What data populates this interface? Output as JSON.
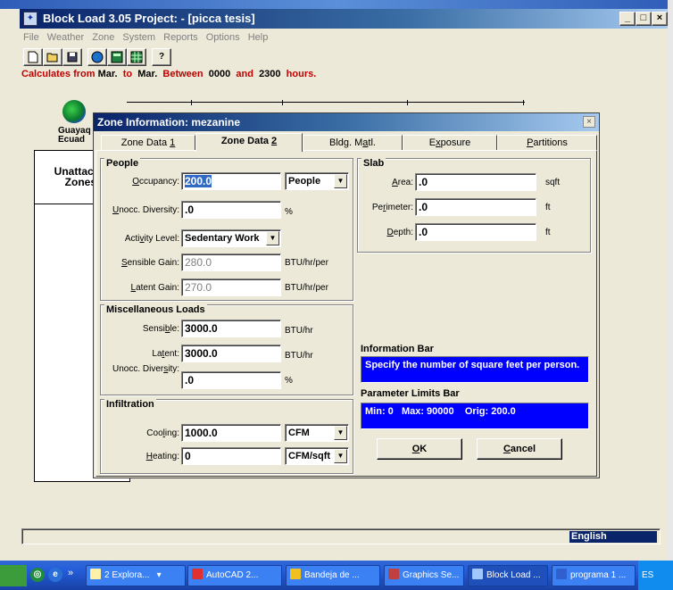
{
  "window": {
    "title": "Block Load  3.05   Project: - [picca tesis]",
    "min_glyph": "_",
    "max_glyph": "□",
    "close_glyph": "×"
  },
  "menu": [
    "File",
    "Weather",
    "Zone",
    "System",
    "Reports",
    "Options",
    "Help"
  ],
  "toolbar": [
    "new-icon",
    "open-icon",
    "save-icon",
    "globe-icon",
    "calc-icon",
    "grid-icon",
    "help-icon"
  ],
  "toolbar_help_glyph": "?",
  "calc_line": {
    "prefix": "Calculates from",
    "from": "Mar.",
    "to_word": "to",
    "to": "Mar.",
    "between_word": "Between",
    "start": "0000",
    "and_word": "and",
    "end": "2300",
    "hours_word": "hours."
  },
  "location": {
    "line1": "Guayaq",
    "line2": "Ecuad"
  },
  "unattached": {
    "line1": "Unattacl",
    "line2": "Zones"
  },
  "status_bar": {
    "language": "English"
  },
  "dialog": {
    "title": "Zone Information: mezanine",
    "close_glyph": "×",
    "tabs": [
      {
        "label": "Zone Data ",
        "accel": "1"
      },
      {
        "label": "Zone Data ",
        "accel": "2"
      },
      {
        "label_pre": "Bldg. M",
        "accel": "a",
        "label_post": "tl."
      },
      {
        "label_pre": "E",
        "accel": "x",
        "label_post": "posure"
      },
      {
        "label_pre": "",
        "accel": "P",
        "label_post": "artitions"
      }
    ],
    "people": {
      "title": "People",
      "occupancy": {
        "label_pre": "",
        "accel": "O",
        "label_post": "ccupancy:",
        "value": "200.0",
        "unit": "People",
        "unit_arrow": "▼"
      },
      "unocc_diversity": {
        "label_pre": "",
        "accel": "U",
        "label_post": "nocc. Diversity:",
        "value": ".0",
        "unit": "%"
      },
      "activity_level": {
        "label_pre": "Acti",
        "accel": "v",
        "label_post": "ity Level:",
        "value": "Sedentary Work",
        "arrow": "▼"
      },
      "sensible_gain": {
        "label_pre": "",
        "accel": "S",
        "label_post": "ensible Gain:",
        "value": "280.0",
        "unit": "BTU/hr/per"
      },
      "latent_gain": {
        "label_pre": "",
        "accel": "L",
        "label_post": "atent Gain:",
        "value": "270.0",
        "unit": "BTU/hr/per"
      }
    },
    "misc": {
      "title": "Miscellaneous Loads",
      "sensible": {
        "label_pre": "Sensi",
        "accel": "b",
        "label_post": "le:",
        "value": "3000.0",
        "unit": "BTU/hr"
      },
      "latent": {
        "label_pre": "La",
        "accel": "t",
        "label_post": "ent:",
        "value": "3000.0",
        "unit": "BTU/hr"
      },
      "unocc_diversity": {
        "label_pre": "Unocc. Diver",
        "accel": "s",
        "label_post": "ity:",
        "value": ".0",
        "unit": "%"
      }
    },
    "infiltration": {
      "title": "Infiltration",
      "cooling": {
        "label_pre": "Coo",
        "accel": "l",
        "label_post": "ing:",
        "value": "1000.0",
        "unit": "CFM",
        "arrow": "▼"
      },
      "heating": {
        "label_pre": "",
        "accel": "H",
        "label_post": "eating:",
        "value": "0",
        "unit": "CFM/sqft",
        "arrow": "▼"
      }
    },
    "slab": {
      "title": "Slab",
      "area": {
        "label_pre": "",
        "accel": "A",
        "label_post": "rea:",
        "value": ".0",
        "unit": "sqft"
      },
      "perimeter": {
        "label_pre": "Pe",
        "accel": "r",
        "label_post": "imeter:",
        "value": ".0",
        "unit": "ft"
      },
      "depth": {
        "label_pre": "",
        "accel": "D",
        "label_post": "epth:",
        "value": ".0",
        "unit": "ft"
      }
    },
    "info_bar": {
      "title": "Information Bar",
      "text": "Specify the number of square feet per person."
    },
    "param_bar": {
      "title": "Parameter Limits Bar",
      "text": "Min: 0   Max: 90000    Orig: 200.0"
    },
    "ok": {
      "accel": "O",
      "rest": "K"
    },
    "cancel": {
      "accel": "C",
      "rest": "ancel"
    }
  },
  "taskbar": {
    "tasks": [
      "2 Explora...",
      "AutoCAD 2...",
      "Bandeja de ...",
      "Graphics Se...",
      "Block Load ...",
      "programa 1 ..."
    ],
    "chevron": "»",
    "dropdown_arrow": "▾",
    "tray_text": "ES"
  }
}
